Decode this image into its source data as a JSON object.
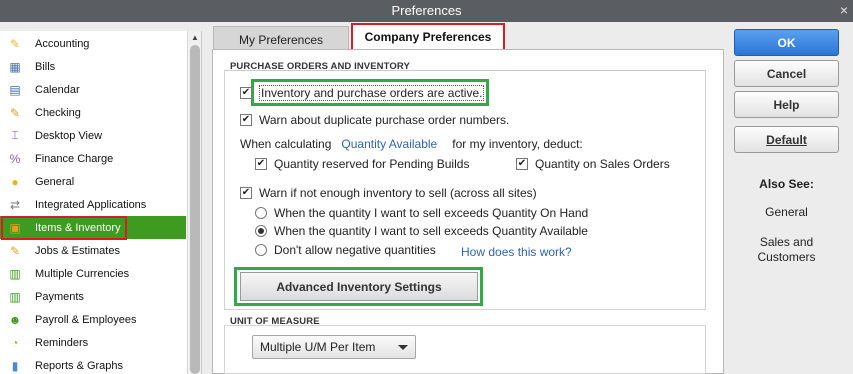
{
  "window": {
    "title": "Preferences",
    "close_glyph": "×"
  },
  "sidebar": {
    "items": [
      {
        "label": "Accounting",
        "icon": "accounting-icon",
        "glyph": "✎",
        "color": "#e8b72c"
      },
      {
        "label": "Bills",
        "icon": "bills-icon",
        "glyph": "▦",
        "color": "#4a6fa8"
      },
      {
        "label": "Calendar",
        "icon": "calendar-icon",
        "glyph": "▤",
        "color": "#3b6ea8"
      },
      {
        "label": "Checking",
        "icon": "checking-icon",
        "glyph": "✎",
        "color": "#d4a520"
      },
      {
        "label": "Desktop View",
        "icon": "desktop-view-icon",
        "glyph": "⌶",
        "color": "#7a4ba0"
      },
      {
        "label": "Finance Charge",
        "icon": "finance-charge-icon",
        "glyph": "%",
        "color": "#8a58b0"
      },
      {
        "label": "General",
        "icon": "general-icon",
        "glyph": "●",
        "color": "#e6b422"
      },
      {
        "label": "Integrated Applications",
        "icon": "integrated-applications-icon",
        "glyph": "⇄",
        "color": "#777"
      },
      {
        "label": "Items & Inventory",
        "icon": "items-inventory-icon",
        "glyph": "▣",
        "color": "#e0a21b",
        "selected": true
      },
      {
        "label": "Jobs & Estimates",
        "icon": "jobs-estimates-icon",
        "glyph": "✎",
        "color": "#d4a520"
      },
      {
        "label": "Multiple Currencies",
        "icon": "multiple-currencies-icon",
        "glyph": "▥",
        "color": "#3d9b1f"
      },
      {
        "label": "Payments",
        "icon": "payments-icon",
        "glyph": "▥",
        "color": "#3d9b1f"
      },
      {
        "label": "Payroll & Employees",
        "icon": "payroll-employees-icon",
        "glyph": "☻",
        "color": "#3d9b1f"
      },
      {
        "label": "Reminders",
        "icon": "reminders-icon",
        "glyph": "◔",
        "color": "#d4a520"
      },
      {
        "label": "Reports & Graphs",
        "icon": "reports-graphs-icon",
        "glyph": "▮",
        "color": "#4a8ad0"
      }
    ]
  },
  "tabs": {
    "my": "My Preferences",
    "company": "Company Preferences"
  },
  "purchase_orders": {
    "section_title": "PURCHASE ORDERS AND INVENTORY",
    "inventory_active": {
      "label": "Inventory and purchase orders are active.",
      "checked": true
    },
    "warn_duplicate": {
      "label": "Warn about duplicate purchase order numbers.",
      "checked": true
    },
    "calc_prefix": "When calculating",
    "calc_link": "Quantity Available",
    "calc_suffix": "for my inventory, deduct:",
    "qty_pending_builds": {
      "label": "Quantity reserved for Pending Builds",
      "checked": true
    },
    "qty_sales_orders": {
      "label": "Quantity on Sales Orders",
      "checked": true
    },
    "warn_not_enough": {
      "label": "Warn if not enough inventory to sell (across all sites)",
      "checked": true
    },
    "radio_on_hand": {
      "label": "When the quantity I want to sell exceeds Quantity On Hand",
      "selected": false
    },
    "radio_available": {
      "label": "When the quantity I want to sell exceeds Quantity Available",
      "selected": true
    },
    "radio_no_negative": {
      "label": "Don't allow negative quantities",
      "selected": false
    },
    "how_link": "How does this work?",
    "advanced_button": "Advanced Inventory Settings"
  },
  "unit_of_measure": {
    "section_title": "UNIT OF MEASURE",
    "selected": "Multiple U/M Per Item"
  },
  "buttons": {
    "ok": "OK",
    "cancel": "Cancel",
    "help": "Help",
    "default": "Default"
  },
  "also_see": {
    "title": "Also See:",
    "links": [
      "General",
      "Sales and Customers"
    ]
  }
}
